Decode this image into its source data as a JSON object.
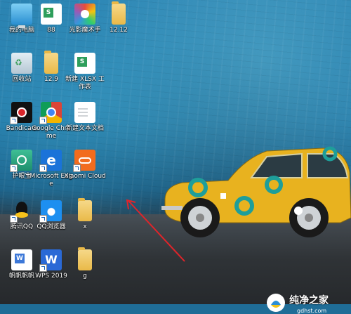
{
  "desktop": {
    "icons": [
      {
        "label": "我的电脑",
        "icon": "computer-icon"
      },
      {
        "label": "88",
        "icon": "spreadsheet-icon"
      },
      {
        "label": "光影魔术手",
        "icon": "aperture-icon"
      },
      {
        "label": "12.12",
        "icon": "folder-icon"
      },
      {
        "label": "回收站",
        "icon": "recycle-bin-icon"
      },
      {
        "label": "12.9",
        "icon": "folder-icon"
      },
      {
        "label": "新建 XLSX 工作表",
        "icon": "spreadsheet-icon"
      },
      {
        "label": "Bandicam",
        "icon": "bandicam-icon"
      },
      {
        "label": "Google Chrome",
        "icon": "chrome-icon"
      },
      {
        "label": "新建文本文档",
        "icon": "text-document-icon"
      },
      {
        "label": "护眼宝",
        "icon": "eye-care-icon"
      },
      {
        "label": "Microsoft Edge",
        "icon": "edge-icon"
      },
      {
        "label": "Xiaomi Cloud",
        "icon": "cloud-icon"
      },
      {
        "label": "腾讯QQ",
        "icon": "qq-penguin-icon"
      },
      {
        "label": "QQ浏览器",
        "icon": "qq-browser-icon"
      },
      {
        "label": "x",
        "icon": "folder-icon"
      },
      {
        "label": "帆帆帆帆",
        "icon": "wps-document-icon"
      },
      {
        "label": "WPS 2019",
        "icon": "wps-icon"
      },
      {
        "label": "g",
        "icon": "folder-icon"
      }
    ],
    "sheet_mark": "S",
    "edge_glyph": "e",
    "wps_glyph": "W"
  },
  "watermark": {
    "text": "纯净之家",
    "url": "gdhst.com"
  },
  "colors": {
    "wall_blue": "#2b84b3",
    "car_yellow": "#e8b21f",
    "car_teal": "#1e9e9a",
    "arrow_red": "#e0242a"
  }
}
